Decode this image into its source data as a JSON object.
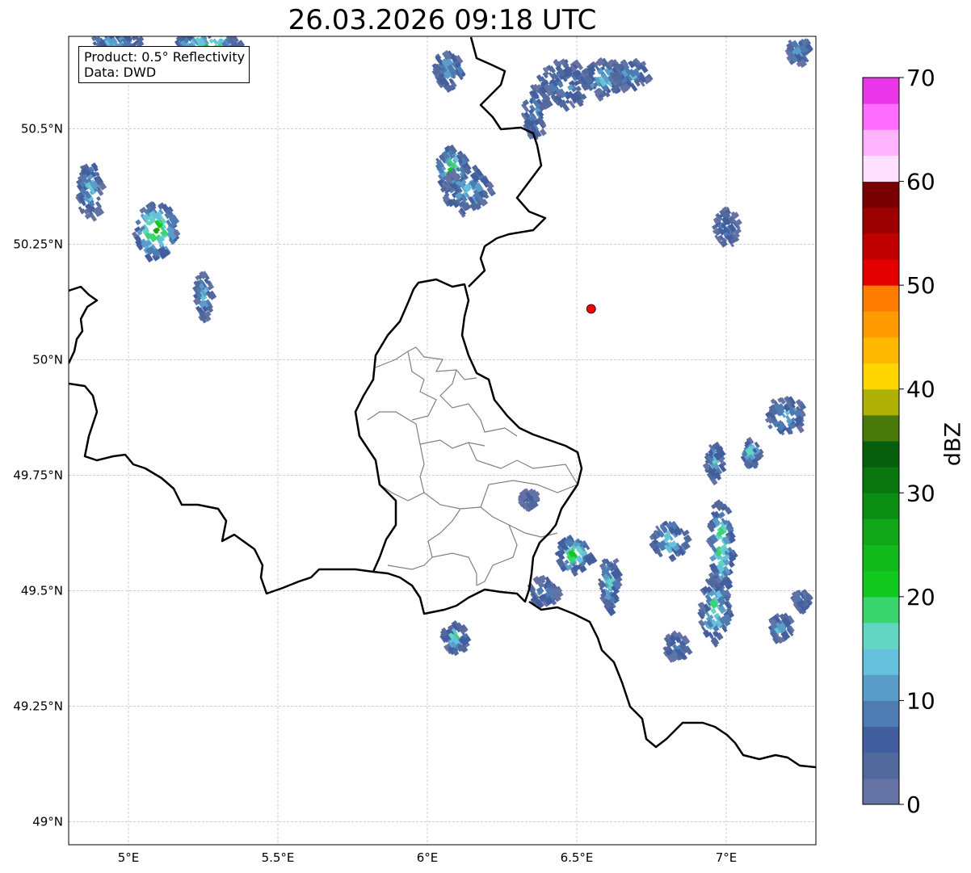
{
  "title": "26.03.2026 09:18 UTC",
  "info": {
    "product": "Product: 0.5° Reflectivity",
    "source": "Data: DWD"
  },
  "map": {
    "lon_range": [
      4.8,
      7.3
    ],
    "lat_range": [
      48.95,
      50.7
    ],
    "lon_ticks": [
      {
        "value": 5.0,
        "label": "5°E"
      },
      {
        "value": 5.5,
        "label": "5.5°E"
      },
      {
        "value": 6.0,
        "label": "6°E"
      },
      {
        "value": 6.5,
        "label": "6.5°E"
      },
      {
        "value": 7.0,
        "label": "7°E"
      }
    ],
    "lat_ticks": [
      {
        "value": 49.0,
        "label": "49°N"
      },
      {
        "value": 49.25,
        "label": "49.25°N"
      },
      {
        "value": 49.5,
        "label": "49.5°N"
      },
      {
        "value": 49.75,
        "label": "49.75°N"
      },
      {
        "value": 50.0,
        "label": "50°N"
      },
      {
        "value": 50.25,
        "label": "50.25°N"
      },
      {
        "value": 50.5,
        "label": "50.5°N"
      }
    ],
    "gridlines": true,
    "radar_site": {
      "lon": 6.548,
      "lat": 50.11,
      "color": "#ff0000"
    },
    "echoes": [
      {
        "lon": 5.08,
        "lat": 50.28,
        "rlon": 0.07,
        "rlat": 0.06,
        "dbz": 26
      },
      {
        "lon": 6.07,
        "lat": 50.41,
        "rlon": 0.05,
        "rlat": 0.05,
        "dbz": 24
      },
      {
        "lon": 6.12,
        "lat": 50.37,
        "rlon": 0.08,
        "rlat": 0.05,
        "dbz": 14
      },
      {
        "lon": 6.45,
        "lat": 50.6,
        "rlon": 0.09,
        "rlat": 0.05,
        "dbz": 10
      },
      {
        "lon": 6.58,
        "lat": 50.61,
        "rlon": 0.08,
        "rlat": 0.04,
        "dbz": 14
      },
      {
        "lon": 6.67,
        "lat": 50.62,
        "rlon": 0.07,
        "rlat": 0.03,
        "dbz": 12
      },
      {
        "lon": 6.35,
        "lat": 50.54,
        "rlon": 0.04,
        "rlat": 0.06,
        "dbz": 12
      },
      {
        "lon": 6.06,
        "lat": 50.63,
        "rlon": 0.05,
        "rlat": 0.04,
        "dbz": 14
      },
      {
        "lon": 4.86,
        "lat": 50.37,
        "rlon": 0.04,
        "rlat": 0.06,
        "dbz": 16
      },
      {
        "lon": 5.24,
        "lat": 50.14,
        "rlon": 0.03,
        "rlat": 0.05,
        "dbz": 14
      },
      {
        "lon": 6.48,
        "lat": 49.58,
        "rlon": 0.06,
        "rlat": 0.04,
        "dbz": 22
      },
      {
        "lon": 6.6,
        "lat": 49.52,
        "rlon": 0.03,
        "rlat": 0.06,
        "dbz": 16
      },
      {
        "lon": 6.8,
        "lat": 49.61,
        "rlon": 0.06,
        "rlat": 0.04,
        "dbz": 18
      },
      {
        "lon": 6.97,
        "lat": 49.6,
        "rlon": 0.04,
        "rlat": 0.1,
        "dbz": 22
      },
      {
        "lon": 6.95,
        "lat": 49.46,
        "rlon": 0.05,
        "rlat": 0.07,
        "dbz": 20
      },
      {
        "lon": 6.95,
        "lat": 49.78,
        "rlon": 0.03,
        "rlat": 0.04,
        "dbz": 14
      },
      {
        "lon": 7.19,
        "lat": 49.88,
        "rlon": 0.07,
        "rlat": 0.04,
        "dbz": 14
      },
      {
        "lon": 7.07,
        "lat": 49.8,
        "rlon": 0.03,
        "rlat": 0.03,
        "dbz": 18
      },
      {
        "lon": 7.17,
        "lat": 49.42,
        "rlon": 0.04,
        "rlat": 0.03,
        "dbz": 14
      },
      {
        "lon": 6.38,
        "lat": 49.5,
        "rlon": 0.05,
        "rlat": 0.03,
        "dbz": 12
      },
      {
        "lon": 6.08,
        "lat": 49.4,
        "rlon": 0.04,
        "rlat": 0.03,
        "dbz": 18
      },
      {
        "lon": 6.82,
        "lat": 49.38,
        "rlon": 0.04,
        "rlat": 0.03,
        "dbz": 12
      },
      {
        "lon": 6.99,
        "lat": 50.29,
        "rlon": 0.04,
        "rlat": 0.04,
        "dbz": 10
      },
      {
        "lon": 7.23,
        "lat": 50.67,
        "rlon": 0.04,
        "rlat": 0.03,
        "dbz": 14
      },
      {
        "lon": 5.25,
        "lat": 50.68,
        "rlon": 0.12,
        "rlat": 0.03,
        "dbz": 22
      },
      {
        "lon": 4.95,
        "lat": 50.69,
        "rlon": 0.08,
        "rlat": 0.02,
        "dbz": 18
      },
      {
        "lon": 7.24,
        "lat": 49.48,
        "rlon": 0.03,
        "rlat": 0.02,
        "dbz": 8
      },
      {
        "lon": 6.33,
        "lat": 49.7,
        "rlon": 0.03,
        "rlat": 0.02,
        "dbz": 8
      }
    ]
  },
  "colorbar": {
    "label": "dBZ",
    "min": 0,
    "max": 70,
    "ticks": [
      0,
      10,
      20,
      30,
      40,
      50,
      60,
      70
    ],
    "colors": [
      "#6472a4",
      "#52699e",
      "#425e9f",
      "#4d7bb2",
      "#5b9dc9",
      "#66c1dc",
      "#62d6c2",
      "#3ad56e",
      "#11c81f",
      "#12b91b",
      "#10a618",
      "#0c8e15",
      "#0a7610",
      "#075e0d",
      "#477a0b",
      "#aeb004",
      "#ffd700",
      "#ffb800",
      "#ff9a00",
      "#ff7c00",
      "#e40000",
      "#c00000",
      "#9d0000",
      "#780000",
      "#ffe0ff",
      "#ffb3ff",
      "#ff6cff",
      "#e836e8"
    ]
  }
}
